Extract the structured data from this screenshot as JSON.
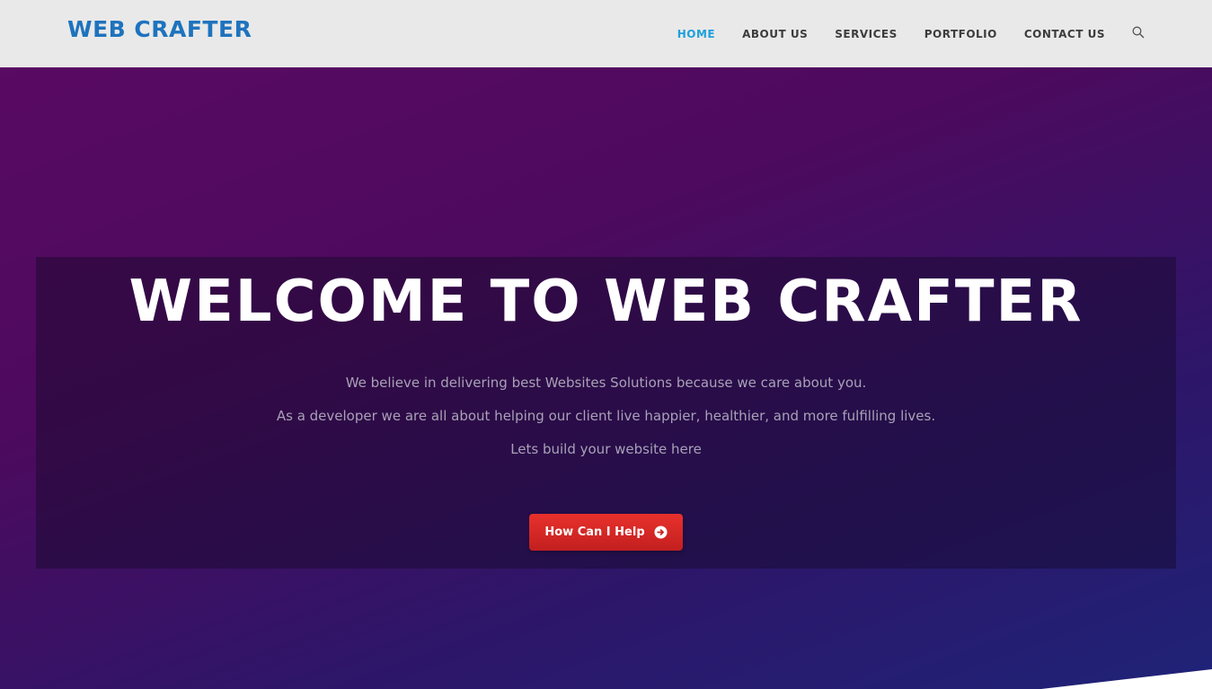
{
  "header": {
    "logo": "WEB CRAFTER",
    "nav": [
      {
        "label": "HOME",
        "active": true
      },
      {
        "label": "ABOUT US"
      },
      {
        "label": "SERVICES"
      },
      {
        "label": "PORTFOLIO"
      },
      {
        "label": "CONTACT US"
      }
    ],
    "search_icon": "search-icon"
  },
  "hero": {
    "title": "WELCOME TO WEB CRAFTER",
    "lines": [
      "We believe in delivering best Websites Solutions because we care about you.",
      "As a developer we are all about helping our client live happier, healthier, and more fulfilling lives.",
      "Lets build your website here"
    ],
    "cta_label": "How Can I Help",
    "cta_icon": "arrow-circle-right-icon"
  },
  "colors": {
    "logo": "#1e73be",
    "nav_active": "#1ea0dc",
    "nav": "#3c3c3c",
    "header_bg": "#e9e9e9",
    "hero_gradient_start": "#590a63",
    "hero_gradient_end": "#1f2378",
    "cta_bg": "#d42626"
  }
}
